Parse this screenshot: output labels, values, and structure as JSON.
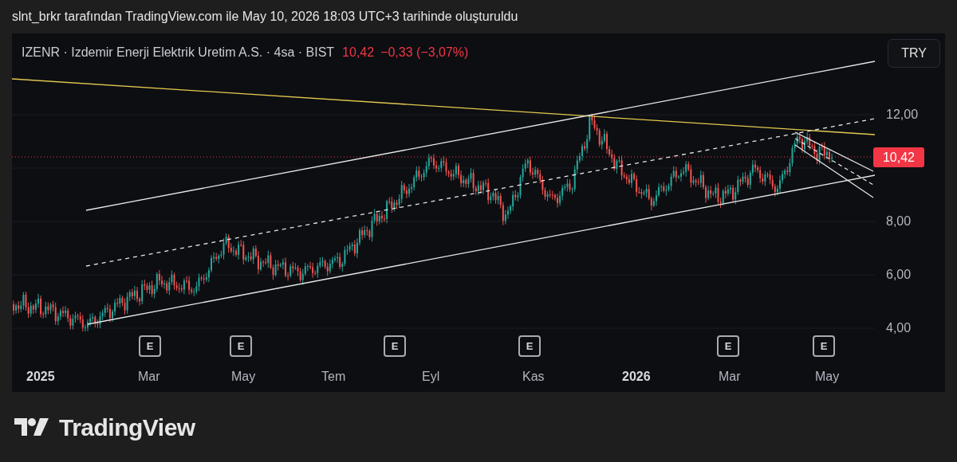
{
  "header": {
    "text": "slnt_brkr tarafından TradingView.com ile May 10, 2026 18:03 UTC+3 tarihinde oluşturuldu"
  },
  "legend": {
    "symbol": "IZENR · Izdemir Enerji Elektrik Uretim A.S. · 4sa · BIST",
    "price": "10,42",
    "change": "−0,33 (−3,07%)"
  },
  "currency_button": "TRY",
  "price_axis": {
    "ticks": [
      "12,00",
      "8,00",
      "6,00",
      "4,00"
    ],
    "last_price": "10,42"
  },
  "event_markers": [
    "E",
    "E",
    "E",
    "E",
    "E",
    "E"
  ],
  "time_axis": [
    {
      "label": "2025",
      "kind": "year"
    },
    {
      "label": "Mar",
      "kind": "month"
    },
    {
      "label": "May",
      "kind": "month"
    },
    {
      "label": "Tem",
      "kind": "month"
    },
    {
      "label": "Eyl",
      "kind": "month"
    },
    {
      "label": "Kas",
      "kind": "month"
    },
    {
      "label": "2026",
      "kind": "year"
    },
    {
      "label": "Mar",
      "kind": "month"
    },
    {
      "label": "May",
      "kind": "month"
    }
  ],
  "logo": {
    "text": "TradingView"
  }
}
